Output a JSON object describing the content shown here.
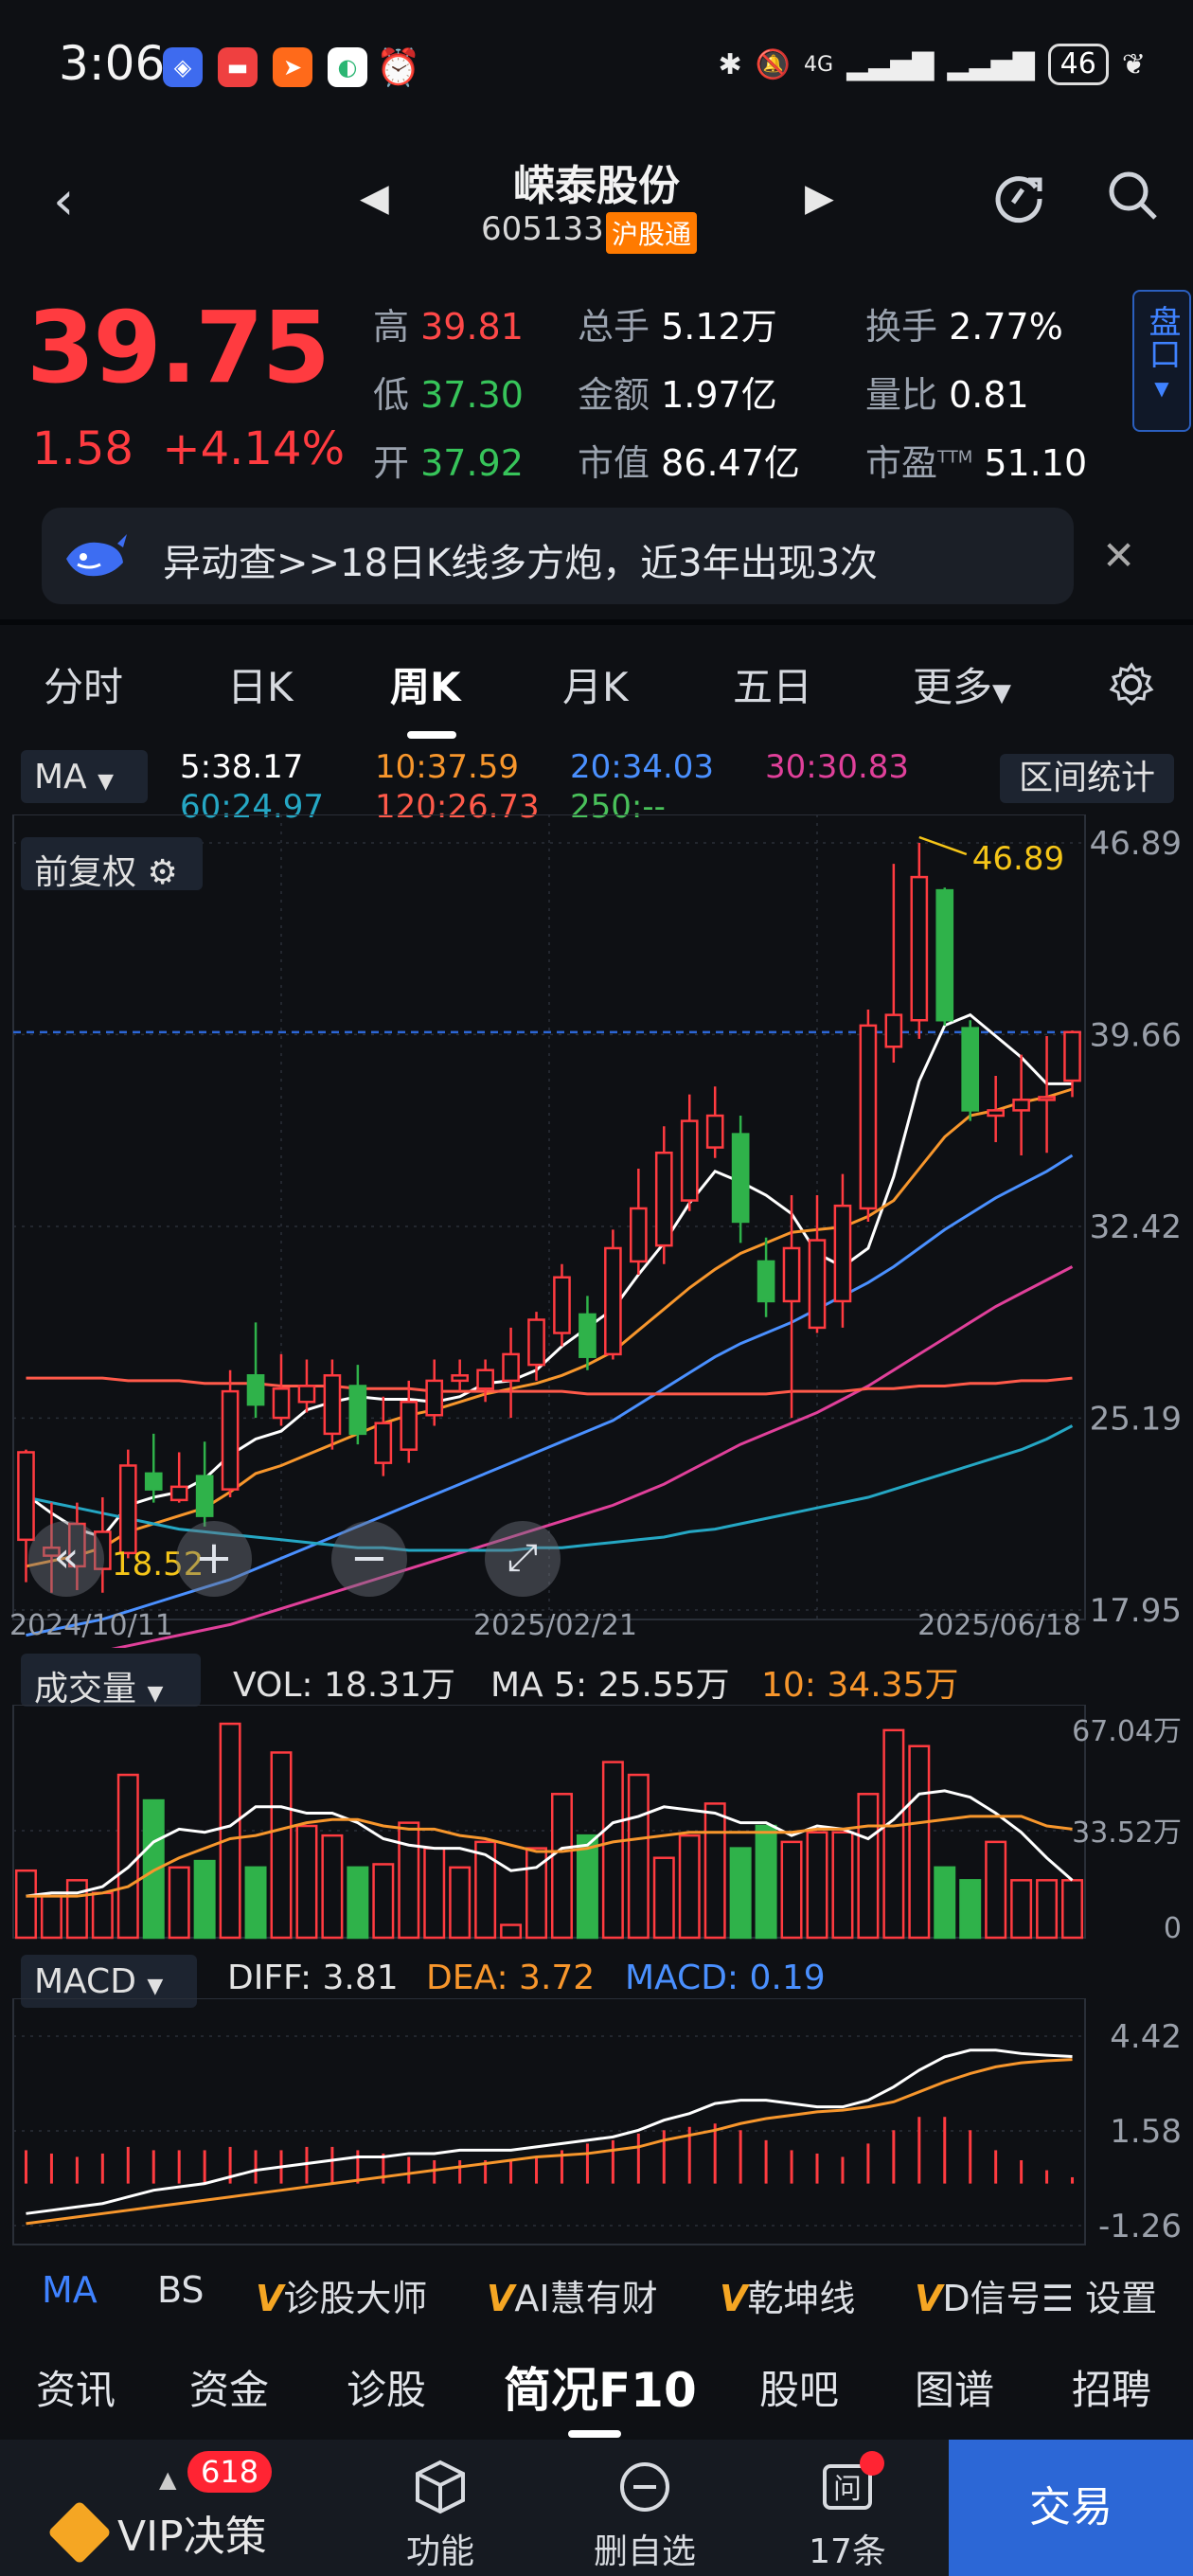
{
  "status": {
    "time": "3:06",
    "network": "4G",
    "battery": "46"
  },
  "header": {
    "name": "嵘泰股份",
    "code": "605133",
    "badge": "沪股通"
  },
  "quote": {
    "price": "39.75",
    "change": "1.58",
    "change_pct": "+4.14%",
    "high_label": "高",
    "high": "39.81",
    "low_label": "低",
    "low": "37.30",
    "open_label": "开",
    "open": "37.92",
    "vol_label": "总手",
    "vol": "5.12万",
    "amt_label": "金额",
    "amt": "1.97亿",
    "mcap_label": "市值",
    "mcap": "86.47亿",
    "turn_label": "换手",
    "turn": "2.77%",
    "ratio_label": "量比",
    "ratio": "0.81",
    "pe_label": "市盈",
    "pe_sup": "TTM",
    "pe": "51.10",
    "pankou": "盘口"
  },
  "alert": {
    "text": "异动查>>18日K线多方炮，近3年出现3次"
  },
  "tabs": {
    "items": [
      "分时",
      "日K",
      "周K",
      "月K",
      "五日",
      "更多"
    ],
    "active": "周K"
  },
  "ma": {
    "button": "MA",
    "ma5": "5:38.17",
    "ma10": "10:37.59",
    "ma20": "20:34.03",
    "ma30": "30:30.83",
    "ma60": "60:24.97",
    "ma120": "120:26.73",
    "ma250": "250:--",
    "range_button": "区间统计",
    "adjust_button": "前复权"
  },
  "chart_data": [
    {
      "type": "candlestick",
      "title": "",
      "ylim": [
        17.95,
        46.89
      ],
      "y_ticks": [
        "46.89",
        "39.66",
        "32.42",
        "25.19",
        "17.95"
      ],
      "x_ticks": [
        "2024/10/11",
        "2025/02/21",
        "2025/06/18"
      ],
      "annotations": {
        "high": "46.89",
        "low": "18.52"
      },
      "current_price": 39.75,
      "candles": [
        {
          "o": 20.6,
          "c": 23.9,
          "h": 24.0,
          "l": 19.0
        },
        {
          "o": 20.0,
          "c": 20.3,
          "h": 22.0,
          "l": 18.6
        },
        {
          "o": 19.6,
          "c": 21.2,
          "h": 22.0,
          "l": 18.7
        },
        {
          "o": 19.5,
          "c": 20.9,
          "h": 22.2,
          "l": 18.6
        },
        {
          "o": 20.1,
          "c": 23.4,
          "h": 24.0,
          "l": 19.9
        },
        {
          "o": 23.1,
          "c": 22.5,
          "h": 24.6,
          "l": 22.0
        },
        {
          "o": 22.1,
          "c": 22.6,
          "h": 23.9,
          "l": 22.0
        },
        {
          "o": 23.0,
          "c": 21.5,
          "h": 24.3,
          "l": 21.1
        },
        {
          "o": 22.5,
          "c": 26.2,
          "h": 27.0,
          "l": 22.2
        },
        {
          "o": 26.8,
          "c": 25.7,
          "h": 28.8,
          "l": 25.2
        },
        {
          "o": 25.2,
          "c": 26.3,
          "h": 27.6,
          "l": 24.9
        },
        {
          "o": 25.8,
          "c": 26.4,
          "h": 27.4,
          "l": 25.4
        },
        {
          "o": 24.6,
          "c": 26.8,
          "h": 27.4,
          "l": 24.0
        },
        {
          "o": 26.4,
          "c": 24.6,
          "h": 27.2,
          "l": 24.2
        },
        {
          "o": 23.5,
          "c": 25.0,
          "h": 26.0,
          "l": 23.0
        },
        {
          "o": 24.0,
          "c": 25.8,
          "h": 26.6,
          "l": 23.5
        },
        {
          "o": 25.3,
          "c": 26.6,
          "h": 27.4,
          "l": 24.9
        },
        {
          "o": 26.6,
          "c": 26.8,
          "h": 27.4,
          "l": 26.2
        },
        {
          "o": 26.3,
          "c": 27.0,
          "h": 27.4,
          "l": 25.8
        },
        {
          "o": 26.6,
          "c": 27.6,
          "h": 28.6,
          "l": 25.2
        },
        {
          "o": 27.2,
          "c": 28.9,
          "h": 29.2,
          "l": 26.6
        },
        {
          "o": 28.4,
          "c": 30.5,
          "h": 31.0,
          "l": 27.9
        },
        {
          "o": 29.1,
          "c": 27.5,
          "h": 29.8,
          "l": 27.0
        },
        {
          "o": 27.6,
          "c": 31.6,
          "h": 32.3,
          "l": 27.4
        },
        {
          "o": 31.1,
          "c": 33.1,
          "h": 34.6,
          "l": 30.6
        },
        {
          "o": 31.7,
          "c": 35.2,
          "h": 36.2,
          "l": 31.0
        },
        {
          "o": 33.4,
          "c": 36.4,
          "h": 37.4,
          "l": 33.0
        },
        {
          "o": 35.4,
          "c": 36.6,
          "h": 37.7,
          "l": 35.0
        },
        {
          "o": 35.9,
          "c": 32.6,
          "h": 36.6,
          "l": 31.8
        },
        {
          "o": 31.1,
          "c": 29.6,
          "h": 32.0,
          "l": 29.0
        },
        {
          "o": 29.6,
          "c": 31.6,
          "h": 33.6,
          "l": 25.2
        },
        {
          "o": 28.6,
          "c": 31.9,
          "h": 33.6,
          "l": 28.4
        },
        {
          "o": 29.6,
          "c": 33.2,
          "h": 34.4,
          "l": 28.6
        },
        {
          "o": 33.1,
          "c": 40.0,
          "h": 40.6,
          "l": 32.6
        },
        {
          "o": 39.2,
          "c": 40.4,
          "h": 46.1,
          "l": 38.6
        },
        {
          "o": 40.2,
          "c": 45.6,
          "h": 46.89,
          "l": 39.5
        },
        {
          "o": 45.1,
          "c": 40.2,
          "h": 45.2,
          "l": 40.0
        },
        {
          "o": 39.9,
          "c": 36.8,
          "h": 40.2,
          "l": 36.4
        },
        {
          "o": 36.6,
          "c": 36.8,
          "h": 38.1,
          "l": 35.6
        },
        {
          "o": 36.8,
          "c": 37.2,
          "h": 38.9,
          "l": 35.1
        },
        {
          "o": 37.2,
          "c": 37.3,
          "h": 39.6,
          "l": 35.2
        },
        {
          "o": 37.92,
          "c": 39.75,
          "h": 39.81,
          "l": 37.3
        }
      ],
      "series": [
        {
          "name": "5",
          "color": "#ffffff",
          "values": [
            22.3,
            21.6,
            21.0,
            20.7,
            21.9,
            22.2,
            22.4,
            22.9,
            23.8,
            24.4,
            24.7,
            25.5,
            25.8,
            26.0,
            25.9,
            25.9,
            25.8,
            26.0,
            26.5,
            26.6,
            27.0,
            27.9,
            28.6,
            29.3,
            30.6,
            31.8,
            33.3,
            34.5,
            34.1,
            33.6,
            32.9,
            31.4,
            30.9,
            31.6,
            34.3,
            37.9,
            40.0,
            40.4,
            39.6,
            38.8,
            37.8,
            37.8
          ]
        },
        {
          "name": "10",
          "color": "#f7962c",
          "values": [
            19.6,
            19.8,
            20.0,
            20.3,
            20.9,
            21.2,
            21.5,
            21.8,
            22.4,
            23.1,
            23.4,
            23.8,
            24.2,
            24.6,
            25.0,
            25.3,
            25.5,
            25.8,
            26.1,
            26.3,
            26.5,
            26.8,
            27.2,
            27.7,
            28.5,
            29.3,
            30.1,
            30.8,
            31.4,
            31.8,
            32.2,
            32.3,
            32.4,
            32.8,
            33.4,
            34.6,
            35.8,
            36.6,
            36.8,
            37.1,
            37.3,
            37.6
          ]
        },
        {
          "name": "20",
          "color": "#4a90ff",
          "values": [
            17.0,
            17.2,
            17.4,
            17.6,
            17.9,
            18.2,
            18.5,
            18.8,
            19.1,
            19.5,
            19.9,
            20.3,
            20.7,
            21.1,
            21.5,
            21.9,
            22.3,
            22.7,
            23.1,
            23.5,
            23.9,
            24.3,
            24.7,
            25.1,
            25.7,
            26.3,
            26.9,
            27.5,
            28.0,
            28.4,
            28.8,
            29.3,
            29.8,
            30.3,
            30.9,
            31.6,
            32.3,
            32.9,
            33.5,
            34.0,
            34.5,
            35.1
          ]
        },
        {
          "name": "30",
          "color": "#e0409a",
          "values": [
            15.8,
            16.0,
            16.2,
            16.4,
            16.6,
            16.8,
            17.0,
            17.2,
            17.4,
            17.7,
            18.0,
            18.3,
            18.6,
            18.9,
            19.2,
            19.5,
            19.8,
            20.1,
            20.4,
            20.7,
            21.0,
            21.3,
            21.6,
            21.9,
            22.3,
            22.7,
            23.2,
            23.7,
            24.2,
            24.6,
            25.0,
            25.4,
            25.9,
            26.4,
            27.0,
            27.6,
            28.2,
            28.8,
            29.4,
            29.9,
            30.4,
            30.9
          ]
        },
        {
          "name": "60",
          "color": "#25a7c4",
          "values": [
            22.2,
            22.0,
            21.8,
            21.6,
            21.4,
            21.2,
            21.0,
            20.9,
            20.8,
            20.7,
            20.6,
            20.5,
            20.4,
            20.3,
            20.3,
            20.2,
            20.2,
            20.2,
            20.2,
            20.2,
            20.3,
            20.3,
            20.4,
            20.5,
            20.6,
            20.7,
            20.9,
            21.0,
            21.2,
            21.4,
            21.6,
            21.8,
            22.0,
            22.2,
            22.5,
            22.8,
            23.1,
            23.4,
            23.7,
            24.0,
            24.4,
            24.9
          ]
        },
        {
          "name": "120",
          "color": "#ff5a4a",
          "values": [
            26.7,
            26.7,
            26.7,
            26.7,
            26.6,
            26.6,
            26.6,
            26.5,
            26.5,
            26.5,
            26.4,
            26.4,
            26.4,
            26.3,
            26.3,
            26.3,
            26.2,
            26.2,
            26.2,
            26.2,
            26.2,
            26.2,
            26.1,
            26.1,
            26.1,
            26.1,
            26.1,
            26.1,
            26.1,
            26.1,
            26.2,
            26.2,
            26.2,
            26.3,
            26.3,
            26.4,
            26.4,
            26.5,
            26.5,
            26.6,
            26.6,
            26.7
          ]
        }
      ]
    },
    {
      "type": "bar",
      "title": "成交量",
      "ylim": [
        0,
        67.04
      ],
      "y_ticks": [
        "67.04万",
        "33.52万",
        "0"
      ],
      "unit": "万",
      "values": [
        21,
        13,
        18,
        14,
        51,
        43,
        22,
        24,
        67,
        22,
        58,
        35,
        32,
        22,
        23,
        36,
        28,
        22,
        30,
        4,
        28,
        45,
        32,
        55,
        51,
        25,
        32,
        42,
        28,
        35,
        30,
        33,
        33,
        45,
        65,
        60,
        22,
        18,
        30,
        18,
        18,
        18
      ],
      "ma5": [
        13,
        14,
        14,
        16,
        22,
        30,
        34,
        33,
        35,
        41,
        41,
        39,
        39,
        36,
        31,
        29,
        28,
        28,
        26,
        21,
        22,
        28,
        29,
        36,
        38,
        41,
        40,
        39,
        36,
        36,
        32,
        35,
        34,
        31,
        37,
        45,
        46,
        44,
        39,
        33,
        25,
        18
      ],
      "ma10": [
        13,
        13,
        13,
        14,
        16,
        21,
        25,
        28,
        31,
        32,
        34,
        36,
        37,
        37,
        35,
        34,
        34,
        32,
        31,
        29,
        27,
        27,
        28,
        30,
        31,
        32,
        33,
        33,
        33,
        33,
        33,
        34,
        34,
        35,
        35,
        36,
        37,
        38,
        38,
        38,
        35,
        34
      ]
    },
    {
      "type": "bar",
      "title": "MACD",
      "ylim": [
        -1.26,
        4.42
      ],
      "y_ticks": [
        "4.42",
        "1.58",
        "-1.26"
      ],
      "macd": [
        1.0,
        0.9,
        0.8,
        0.9,
        1.1,
        1.0,
        1.0,
        1.0,
        1.1,
        1.0,
        1.0,
        1.1,
        1.1,
        1.0,
        0.9,
        0.8,
        0.7,
        0.7,
        0.7,
        0.7,
        0.8,
        1.0,
        1.2,
        1.3,
        1.5,
        1.6,
        1.7,
        1.8,
        1.6,
        1.3,
        1.0,
        0.9,
        0.8,
        1.2,
        1.6,
        2.0,
        2.0,
        1.6,
        1.0,
        0.7,
        0.4,
        0.19
      ],
      "diff": [
        -0.9,
        -0.8,
        -0.7,
        -0.6,
        -0.4,
        -0.2,
        -0.1,
        0.0,
        0.2,
        0.4,
        0.5,
        0.6,
        0.7,
        0.8,
        0.8,
        0.9,
        0.9,
        1.0,
        1.0,
        1.0,
        1.1,
        1.2,
        1.3,
        1.4,
        1.6,
        1.9,
        2.1,
        2.4,
        2.5,
        2.5,
        2.4,
        2.3,
        2.3,
        2.5,
        2.9,
        3.4,
        3.8,
        4.0,
        4.0,
        3.9,
        3.85,
        3.81
      ],
      "dea": [
        -1.2,
        -1.1,
        -1.0,
        -0.9,
        -0.8,
        -0.7,
        -0.6,
        -0.5,
        -0.4,
        -0.3,
        -0.2,
        -0.1,
        0.0,
        0.1,
        0.2,
        0.3,
        0.4,
        0.5,
        0.6,
        0.7,
        0.8,
        0.85,
        0.9,
        1.0,
        1.1,
        1.3,
        1.45,
        1.6,
        1.8,
        1.95,
        2.05,
        2.15,
        2.2,
        2.3,
        2.45,
        2.75,
        3.05,
        3.3,
        3.5,
        3.62,
        3.68,
        3.72
      ]
    }
  ],
  "volume_panel": {
    "button": "成交量",
    "vol": "VOL: 18.31万",
    "ma5": "MA 5: 25.55万",
    "ma10": "10: 34.35万"
  },
  "macd_panel": {
    "button": "MACD",
    "diff": "DIFF: 3.81",
    "dea": "DEA: 3.72",
    "macd": "MACD: 0.19"
  },
  "indicators": {
    "items": [
      "MA",
      "BS",
      "诊股大师",
      "AI慧有财",
      "乾坤线",
      "D信号"
    ],
    "prefix": "V",
    "settings": "设置"
  },
  "info_tabs": {
    "items": [
      "资讯",
      "资金",
      "诊股",
      "简况F10",
      "股吧",
      "图谱",
      "招聘"
    ],
    "active": "简况F10"
  },
  "bottom_bar": {
    "vip": "VIP决策",
    "vip_badge": "618",
    "func": "功能",
    "delete": "删自选",
    "ask": "17条",
    "trade": "交易"
  },
  "colors": {
    "up": "#ff3b40",
    "down": "#2fb24a",
    "accent": "#2c67d6",
    "ma5": "#ffffff",
    "ma10": "#f7962c",
    "ma20": "#4a90ff",
    "ma30": "#e0409a",
    "ma60": "#25a7c4",
    "ma120": "#ff5a4a",
    "ma250": "#49c15a"
  }
}
